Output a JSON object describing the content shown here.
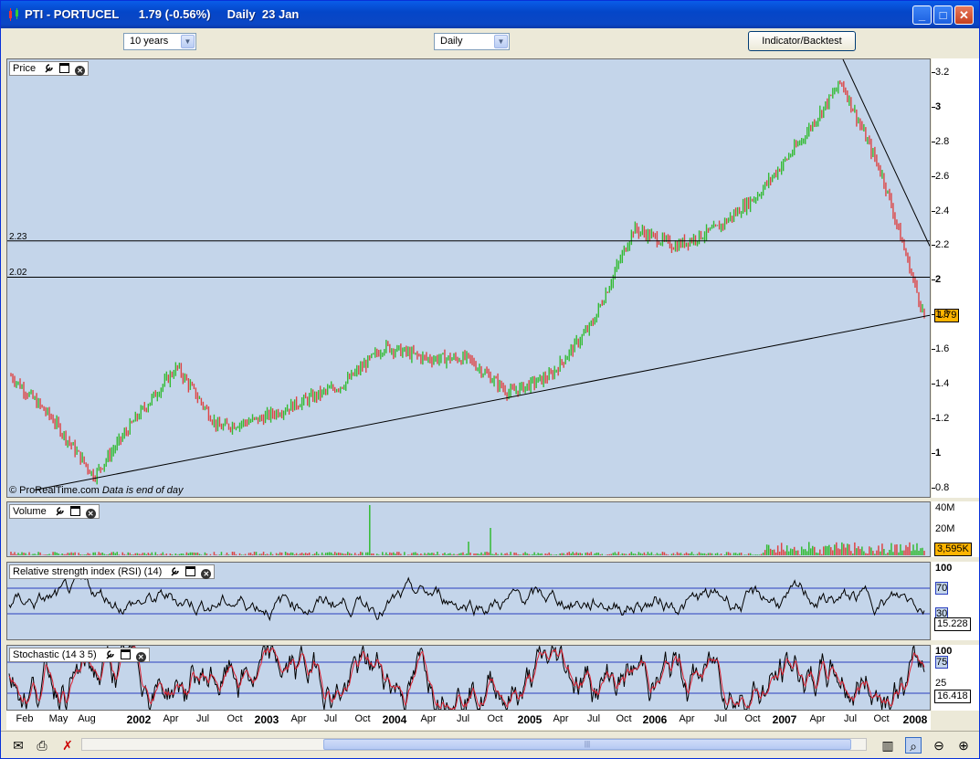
{
  "window": {
    "title": "PTI - PORTUCEL",
    "price": "1.79",
    "change": "(-0.56%)",
    "period": "Daily",
    "date": "23 Jan",
    "buttons": [
      "minimize",
      "maximize",
      "close"
    ]
  },
  "toolbar": {
    "range": "10 years",
    "interval": "Daily",
    "indicator_button": "Indicator/Backtest"
  },
  "price_panel": {
    "title": "Price",
    "watermark": "ProRealTime.com",
    "note": "Data is end of day",
    "current_price": "1.79",
    "current_color": "#ffb400",
    "hlines": [
      "2.23",
      "2.02"
    ],
    "yticks": [
      "3.2",
      "3",
      "2.8",
      "2.6",
      "2.4",
      "2.2",
      "2",
      "1.8",
      "1.6",
      "1.4",
      "1.2",
      "1",
      "0.8"
    ]
  },
  "volume_panel": {
    "title": "Volume",
    "yticks": [
      "40M",
      "20M"
    ],
    "current": "3,595K"
  },
  "rsi_panel": {
    "title": "Relative strength index (RSI) (14)",
    "yticks": [
      "100",
      "70",
      "30",
      "0"
    ],
    "current": "15.228"
  },
  "stoch_panel": {
    "title": "Stochastic (14 3 5)",
    "yticks": [
      "100",
      "75",
      "25",
      "0"
    ],
    "current": "16.418"
  },
  "xaxis": {
    "labels": [
      {
        "t": "Feb",
        "b": false
      },
      {
        "t": "May",
        "b": false
      },
      {
        "t": "Aug",
        "b": false
      },
      {
        "t": "2002",
        "b": true
      },
      {
        "t": "Apr",
        "b": false
      },
      {
        "t": "Jul",
        "b": false
      },
      {
        "t": "Oct",
        "b": false
      },
      {
        "t": "2003",
        "b": true
      },
      {
        "t": "Apr",
        "b": false
      },
      {
        "t": "Jul",
        "b": false
      },
      {
        "t": "Oct",
        "b": false
      },
      {
        "t": "2004",
        "b": true
      },
      {
        "t": "Apr",
        "b": false
      },
      {
        "t": "Jul",
        "b": false
      },
      {
        "t": "Oct",
        "b": false
      },
      {
        "t": "2005",
        "b": true
      },
      {
        "t": "Apr",
        "b": false
      },
      {
        "t": "Jul",
        "b": false
      },
      {
        "t": "Oct",
        "b": false
      },
      {
        "t": "2006",
        "b": true
      },
      {
        "t": "Apr",
        "b": false
      },
      {
        "t": "Jul",
        "b": false
      },
      {
        "t": "Oct",
        "b": false
      },
      {
        "t": "2007",
        "b": true
      },
      {
        "t": "Apr",
        "b": false
      },
      {
        "t": "Jul",
        "b": false
      },
      {
        "t": "Oct",
        "b": false
      },
      {
        "t": "2008",
        "b": true
      }
    ]
  },
  "colors": {
    "bg": "#c4d5ea",
    "up": "#33bb33",
    "down": "#dd4444",
    "line": "#000000",
    "band": "#2a3fbf"
  },
  "chart_data": {
    "type": "line",
    "title": "PTI - PORTUCEL",
    "series": [
      {
        "x": [
          "2001-01",
          "2001-05",
          "2001-08",
          "2002-01",
          "2002-04",
          "2002-07",
          "2003-01",
          "2003-07",
          "2004-01",
          "2004-04",
          "2004-07",
          "2004-10",
          "2005-01",
          "2005-07",
          "2006-01",
          "2006-04",
          "2006-07",
          "2006-10",
          "2007-01",
          "2007-04",
          "2007-07",
          "2007-10",
          "2008-01"
        ],
        "values": [
          1.45,
          1.2,
          0.87,
          1.2,
          1.5,
          1.15,
          1.2,
          1.3,
          1.4,
          1.62,
          1.55,
          1.55,
          1.35,
          1.45,
          1.75,
          2.3,
          2.2,
          2.3,
          2.5,
          2.8,
          3.15,
          2.6,
          1.79
        ]
      }
    ],
    "ylim": [
      0.75,
      3.28
    ]
  }
}
